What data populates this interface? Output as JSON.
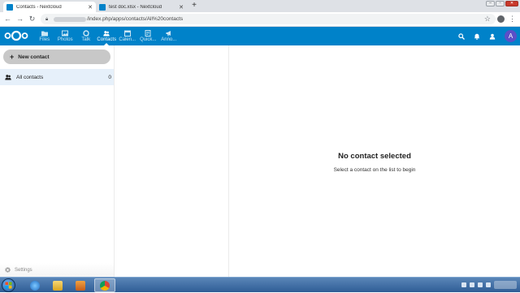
{
  "browser": {
    "tabs": [
      {
        "title": "Contacts - Nextcloud",
        "active": true
      },
      {
        "title": "test doc.xlsx - Nextcloud",
        "active": false
      }
    ],
    "url_path": "/index.php/apps/contacts/All%20contacts"
  },
  "header": {
    "apps": [
      {
        "label": "Files",
        "icon": "folder-icon"
      },
      {
        "label": "Photos",
        "icon": "image-icon"
      },
      {
        "label": "Talk",
        "icon": "talk-icon"
      },
      {
        "label": "Contacts",
        "icon": "contacts-icon",
        "active": true
      },
      {
        "label": "Calen...",
        "icon": "calendar-icon"
      },
      {
        "label": "Quick...",
        "icon": "notes-icon"
      },
      {
        "label": "Anno...",
        "icon": "announcement-icon"
      }
    ],
    "avatar_letter": "A"
  },
  "sidebar": {
    "new_contact_label": "New contact",
    "nav": [
      {
        "label": "All contacts",
        "count": "0"
      }
    ],
    "settings_label": "Settings"
  },
  "detail": {
    "empty_title": "No contact selected",
    "empty_subtitle": "Select a contact on the list to begin"
  },
  "colors": {
    "brand": "#0082c9",
    "avatar": "#5b4fc7",
    "selected_nav": "#e6f0fa"
  }
}
